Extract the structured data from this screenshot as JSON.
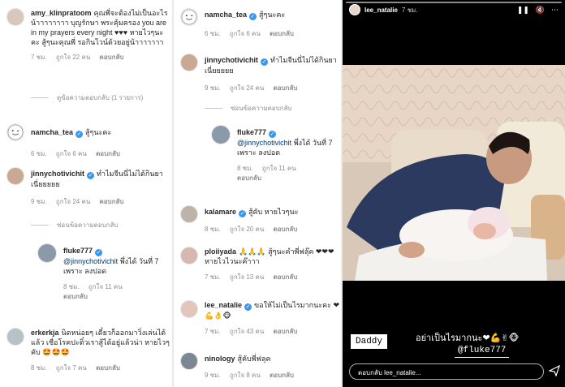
{
  "panel1": {
    "c1": {
      "user": "amy_klinpratoom",
      "text": "คุณพี่จะต้องไม่เป็นอะไรน้าาาาาาาา บุญรักษา พระคุ้มครอง you are in my prayers every night ♥♥♥ หายไวๆนะคะ สู้ๆนะคุณพี่ รอกินไวน์ด้วยอยู่น้าาาาาาา",
      "time": "7 ชม.",
      "likes": "ถูกใจ 22 คน",
      "reply": "ตอบกลับ"
    },
    "c1_thread": "ดูข้อความตอบกลับ (1 รายการ)",
    "c2": {
      "user": "namcha_tea",
      "text": "สู้ๆนะคะ",
      "time": "6 ชม.",
      "likes": "ถูกใจ 6 คน",
      "reply": "ตอบกลับ"
    },
    "c3": {
      "user": "jinnychotivichit",
      "text": "ทำไมจีนนี่ไม่ได้กินยาเนี่ยยยยย",
      "time": "9 ชม.",
      "likes": "ถูกใจ 24 คน",
      "reply": "ตอบกลับ"
    },
    "c3_thread": "ซ่อนข้อความตอบกลับ",
    "c4": {
      "user": "fluke777",
      "mention": "@jinnychotivichit",
      "text": "พึ่งได้ วันที่ 7 เพราะ ลงปอด",
      "time": "8 ชม.",
      "likes": "ถูกใจ 11 คน",
      "reply": "ตอบกลับ"
    },
    "c5": {
      "user": "erkerkja",
      "text": "นิดหน่อยๆ เดี๋ยวก็ออกมาวิ่งเล่นได้แล้ว เชื่อโรคปะติ๋วเราสู้ได้อยู่แล้วน่า หายไวๆคับ 🤩🤩🤩",
      "time": "8 ชม.",
      "likes": "ถูกใจ 7 คน",
      "reply": "ตอบกลับ"
    }
  },
  "panel2": {
    "c1": {
      "user": "namcha_tea",
      "text": "สู้ๆนะคะ",
      "time": "6 ชม.",
      "likes": "ถูกใจ 6 คน",
      "reply": "ตอบกลับ"
    },
    "c2": {
      "user": "jinnychotivichit",
      "text": "ทำไมจีนนี่ไม่ได้กินยาเนี่ยยยยย",
      "time": "9 ชม.",
      "likes": "ถูกใจ 24 คน",
      "reply": "ตอบกลับ"
    },
    "c2_thread": "ซ่อนข้อความตอบกลับ",
    "c3": {
      "user": "fluke777",
      "mention": "@jinnychotivichit",
      "text": "พึ่งได้ วันที่ 7 เพราะ ลงปอด",
      "time": "8 ชม.",
      "likes": "ถูกใจ 11 คน",
      "reply": "ตอบกลับ"
    },
    "c4": {
      "user": "kalamare",
      "text": "สู้คับ หายไวๆนะ",
      "time": "8 ชม.",
      "likes": "ถูกใจ 20 คน",
      "reply": "ตอบกลับ"
    },
    "c5": {
      "user": "ploiiyada",
      "text": "🙏🙏🙏 สู้ๆนะคำพี่ฟลุ๊ค ❤❤❤ หายไวไวนะค๊าาา",
      "time": "7 ชม.",
      "likes": "ถูกใจ 13 คน",
      "reply": "ตอบกลับ"
    },
    "c6": {
      "user": "lee_natalie",
      "text": "ขอให้ไม่เป็นไรมากนะคะ ❤💪👌🐵",
      "time": "7 ชม.",
      "likes": "ถูกใจ 43 คน",
      "reply": "ตอบกลับ"
    },
    "c7": {
      "user": "ninology",
      "text": "สู้คับพี่ฟลุค",
      "time": "9 ชม.",
      "likes": "ถูกใจ 8 คน",
      "reply": "ตอบกลับ"
    }
  },
  "story": {
    "user": "lee_natalie",
    "time": "7 ชม.",
    "caption_daddy": "Daddy",
    "caption_thai": "อย่าเป็นไรมากนะ❤💪✌🐵",
    "caption_mention": "@fluke777",
    "reply_placeholder": "ตอบกลับ lee_natalie..."
  },
  "colors": {
    "verified": "#3897f0",
    "meta": "#8e8e8e",
    "mention": "#00376b",
    "heart": "#ed4956"
  }
}
